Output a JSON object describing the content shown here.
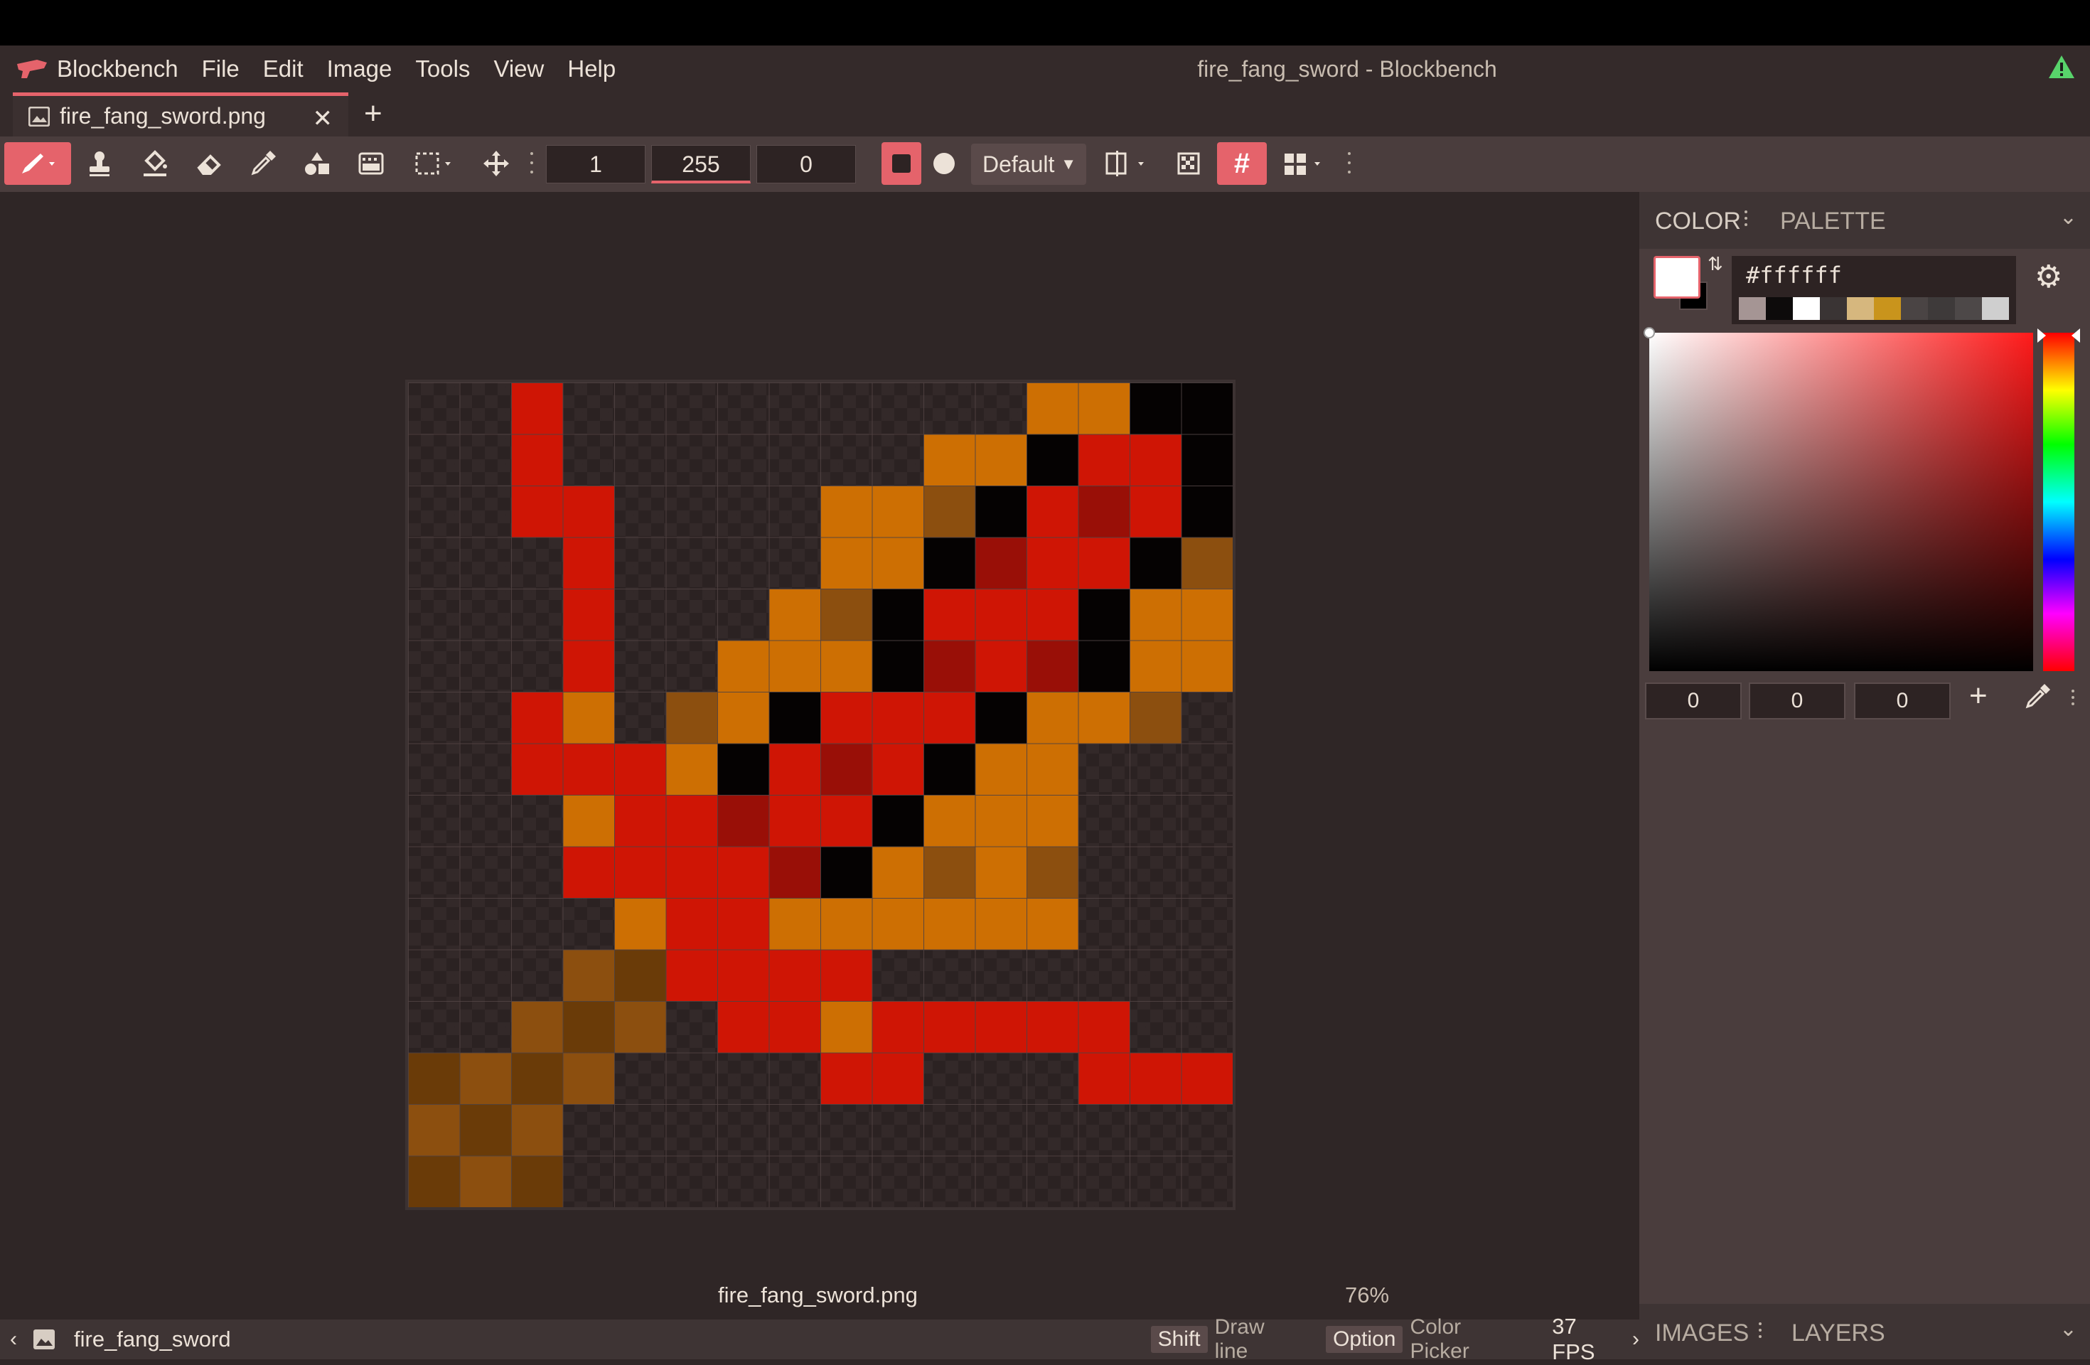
{
  "app": {
    "name": "Blockbench",
    "window_title": "fire_fang_sword - Blockbench",
    "menu": [
      "File",
      "Edit",
      "Image",
      "Tools",
      "View",
      "Help"
    ]
  },
  "tab": {
    "label": "fire_fang_sword.png"
  },
  "toolbar": {
    "size": "1",
    "opacity": "255",
    "softness": "0",
    "mode": "Default"
  },
  "canvas": {
    "filename": "fire_fang_sword.png",
    "zoom": "76%",
    "grid": 16,
    "palette": {
      "R": "#cf1505",
      "D": "#990f07",
      "O": "#cd6f03",
      "B": "#8c4f0f",
      "K": "#050202",
      "Z": "#6a3b08"
    },
    "pixels": [
      "..R.........OOKK",
      "..R.......OOKRRK",
      "..RR....OOBKRDRK",
      "...R....OOKDRRKB",
      "...R...OBKRRRKOO",
      "...R..OOOKDRDKOO",
      "..RO.BOKRRRKOOB.",
      "..RRROKRDRKOO...",
      "...ORRDRRKOOO...",
      "...RRRRDKOBOB...",
      "....ORROOOOOO...",
      "...BZRRRR.......",
      "..BZB.RRORRRRR..",
      "ZBZB....RR...RRR",
      "BZB.............",
      "ZBZ............."
    ]
  },
  "status": {
    "texture_name": "fire_fang_sword",
    "shift_key": "Shift",
    "shift_hint": "Draw line",
    "option_key": "Option",
    "option_hint": "Color Picker",
    "fps": "37 FPS"
  },
  "color_panel": {
    "tab_color": "COLOR",
    "tab_palette": "PALETTE",
    "hex": "#ffffff",
    "primary_color": "#ffffff",
    "secondary_color": "#000000",
    "recent_swatches": [
      "#a59594",
      "#0d0b0b",
      "#ffffff",
      "#3a3434",
      "#d6b77e",
      "#c9941c",
      "#4a4444",
      "#3e3a3a",
      "#4d4848",
      "#cfcfcf"
    ],
    "r": "0",
    "g": "0",
    "b": "0"
  },
  "bottom_panel": {
    "tab_images": "IMAGES",
    "tab_layers": "LAYERS"
  },
  "colors": {
    "accent": "#e5636b",
    "warning": "#58d36b"
  }
}
